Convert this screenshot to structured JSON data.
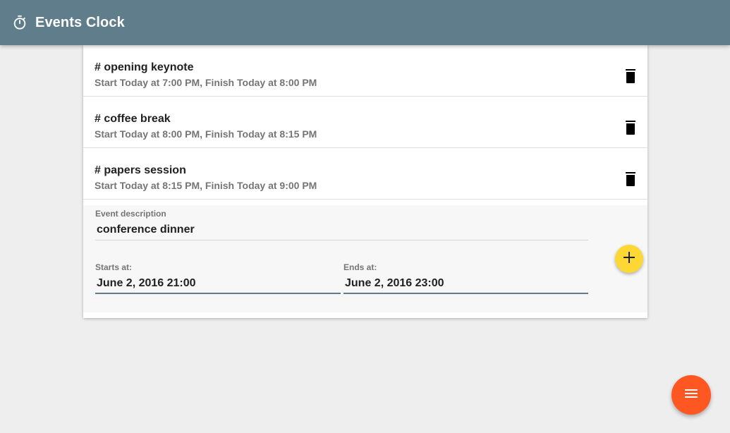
{
  "app": {
    "title": "Events Clock",
    "icon": "stopwatch-icon"
  },
  "events": [
    {
      "description": "# opening keynote",
      "times": "Start Today at 7:00 PM, Finish Today at 8:00 PM",
      "delete_icon": "trash-icon"
    },
    {
      "description": "# coffee break",
      "times": "Start Today at 8:00 PM, Finish Today at 8:15 PM",
      "delete_icon": "trash-icon"
    },
    {
      "description": "# papers session",
      "times": "Start Today at 8:15 PM, Finish Today at 9:00 PM",
      "delete_icon": "trash-icon"
    }
  ],
  "form": {
    "description_label": "Event description",
    "description_value": "conference dinner",
    "starts_label": "Starts at:",
    "starts_value": "June 2, 2016 21:00",
    "ends_label": "Ends at:",
    "ends_value": "June 2, 2016 23:00",
    "add_icon": "plus-icon"
  },
  "fab": {
    "icon": "menu-icon"
  },
  "colors": {
    "appbar": "#607d8b",
    "add_button": "#fdd835",
    "menu_button": "#ff5722",
    "background": "#eeeeee"
  }
}
